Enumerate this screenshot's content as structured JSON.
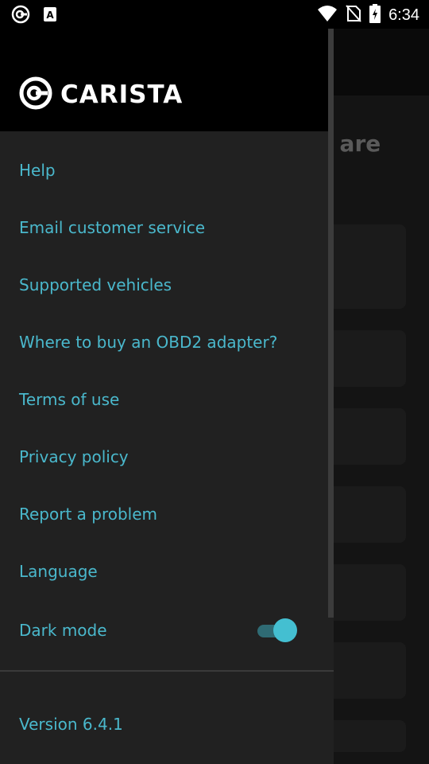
{
  "status_bar": {
    "time": "6:34",
    "left_icons": [
      "carista-notification-icon",
      "font-a-icon"
    ],
    "right_icons": [
      "wifi-icon",
      "no-sim-icon",
      "battery-charging-icon"
    ]
  },
  "background": {
    "heading_fragment": "r are"
  },
  "drawer": {
    "logo_text": "CARISTA",
    "menu": [
      {
        "label": "Help"
      },
      {
        "label": "Email customer service"
      },
      {
        "label": "Supported vehicles"
      },
      {
        "label": "Where to buy an OBD2 adapter?"
      },
      {
        "label": "Terms of use"
      },
      {
        "label": "Privacy policy"
      },
      {
        "label": "Report a problem"
      },
      {
        "label": "Language"
      }
    ],
    "dark_mode": {
      "label": "Dark mode",
      "enabled": true
    },
    "version": "Version 6.4.1"
  },
  "colors": {
    "accent": "#4ab8cc",
    "drawer_bg": "#212121",
    "header_bg": "#000000"
  }
}
